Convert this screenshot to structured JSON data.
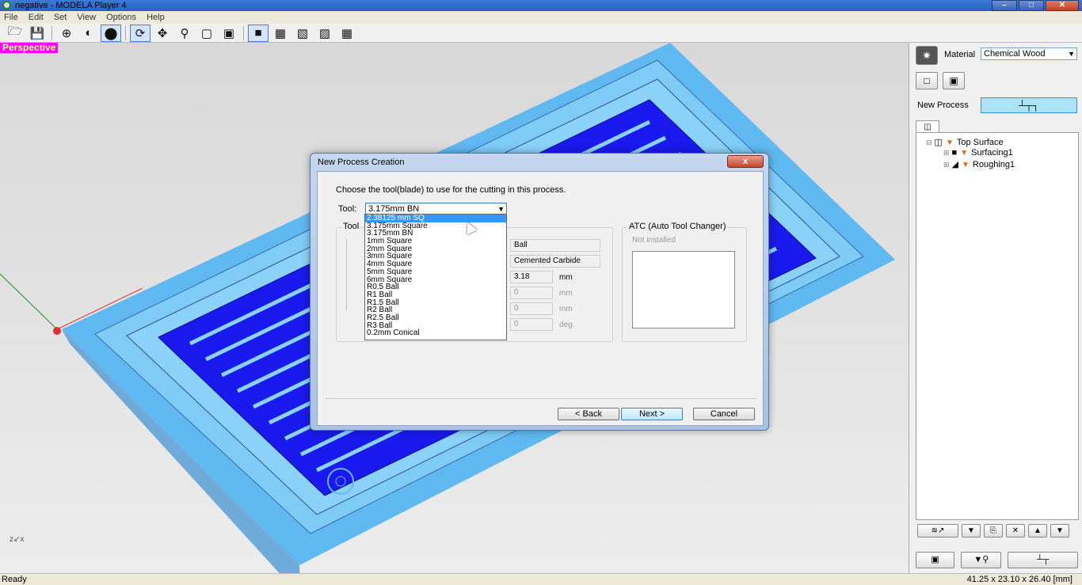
{
  "window": {
    "title": "negative - MODELA Player 4",
    "buttons": [
      "–",
      "□",
      "✕"
    ]
  },
  "menu": [
    "File",
    "Edit",
    "Set",
    "View",
    "Options",
    "Help"
  ],
  "toolbar": {
    "icons": [
      "open-icon",
      "save-icon",
      "globe-icon",
      "globe-outline-icon",
      "shade-icon",
      "rotate-icon",
      "pan-icon",
      "zoom-icon",
      "zoom-box-icon",
      "zoom-fit-icon",
      "view-iso-icon",
      "view-top-icon",
      "view-front-icon",
      "view-right-icon",
      "view-grid-icon"
    ]
  },
  "viewport": {
    "label": "Perspective",
    "axis_label": "z↙x"
  },
  "side": {
    "material_label": "Material",
    "material_value": "Chemical Wood",
    "new_process_label": "New Process",
    "new_process_button": "┴┬┐",
    "tree": [
      {
        "label": "Top Surface",
        "level": 0
      },
      {
        "label": "Surfacing1",
        "level": 1
      },
      {
        "label": "Roughing1",
        "level": 1
      }
    ],
    "bottom_buttons": [
      "≋↗",
      "▼",
      "⎘",
      "✕",
      "▲",
      "▼"
    ],
    "big_buttons": [
      "▣",
      "▼⚲",
      "┴┬"
    ]
  },
  "status": {
    "left": "Ready",
    "right": "41.25 x 23.10 x 26.40 [mm]"
  },
  "dialog": {
    "title": "New Process Creation",
    "close": "x",
    "prompt": "Choose the tool(blade) to use for the cutting in this process.",
    "tool_label": "Tool:",
    "tool_value": "3.175mm BN",
    "group_tool_title": "Tool",
    "group_atc_title": "ATC (Auto Tool Changer)",
    "atc_status": "Not installed",
    "fields": {
      "shape": "Ball",
      "material": "Cemented Carbide",
      "diameter": "3.18",
      "diameter_unit": "mm",
      "f2": "0",
      "f2_unit": "mm",
      "f3": "0",
      "f3_unit": "mm",
      "f4": "0",
      "f4_unit": "deg."
    },
    "buttons": {
      "back": "< Back",
      "next": "Next >",
      "cancel": "Cancel"
    },
    "dropdown": [
      "2.38125 mm SQ",
      "3.175mm Square",
      "3.175mm BN",
      "1mm Square",
      "2mm Square",
      "3mm Square",
      "4mm Square",
      "5mm Square",
      "6mm Square",
      "R0.5 Ball",
      "R1 Ball",
      "R1.5 Ball",
      "R2 Ball",
      "R2.5 Ball",
      "R3 Ball",
      "0.2mm Conical"
    ],
    "dropdown_selected_index": 0
  }
}
